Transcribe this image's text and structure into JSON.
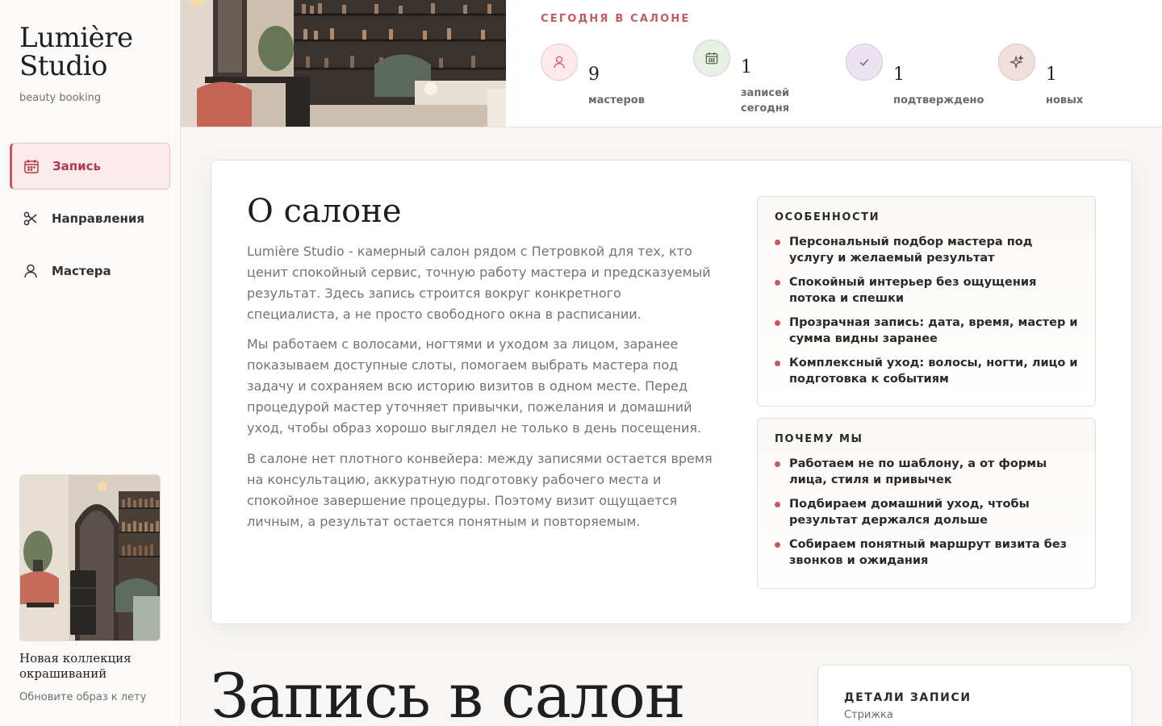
{
  "brand": {
    "name_line1": "Lumière",
    "name_line2": "Studio",
    "subtitle": "beauty booking"
  },
  "sidebar": {
    "items": [
      {
        "label": "Запись",
        "icon": "calendar-icon",
        "active": true
      },
      {
        "label": "Направления",
        "icon": "scissors-icon",
        "active": false
      },
      {
        "label": "Мастера",
        "icon": "user-icon",
        "active": false
      }
    ],
    "promo": {
      "title": "Новая коллекция окрашиваний",
      "subtitle": "Обновите образ к лету"
    }
  },
  "today": {
    "label": "СЕГОДНЯ В САЛОНЕ",
    "stats": [
      {
        "value": "9",
        "caption": "мастеров",
        "icon": "user-icon",
        "color": "#fbe9ec"
      },
      {
        "value": "1",
        "caption": "записей сегодня",
        "icon": "calendar-icon",
        "color": "#e8efe5"
      },
      {
        "value": "1",
        "caption": "подтверждено",
        "icon": "check-icon",
        "color": "#ebe3f2"
      },
      {
        "value": "1",
        "caption": "новых",
        "icon": "sparkle-icon",
        "color": "#efe0dd"
      }
    ]
  },
  "about": {
    "title": "О салоне",
    "paragraphs": [
      "Lumière Studio - камерный салон рядом с Петровкой для тех, кто ценит спокойный сервис, точную работу мастера и предсказуемый результат. Здесь запись строится вокруг конкретного специалиста, а не просто свободного окна в расписании.",
      "Мы работаем с волосами, ногтями и уходом за лицом, заранее показываем доступные слоты, помогаем выбрать мастера под задачу и сохраняем всю историю визитов в одном месте. Перед процедурой мастер уточняет привычки, пожелания и домашний уход, чтобы образ хорошо выглядел не только в день посещения.",
      "В салоне нет плотного конвейера: между записями остается время на консультацию, аккуратную подготовку рабочего места и спокойное завершение процедуры. Поэтому визит ощущается личным, а результат остается понятным и повторяемым."
    ],
    "features": {
      "title": "ОСОБЕННОСТИ",
      "items": [
        "Персональный подбор мастера под услугу и желаемый результат",
        "Спокойный интерьер без ощущения потока и спешки",
        "Прозрачная запись: дата, время, мастер и сумма видны заранее",
        "Комплексный уход: волосы, ногти, лицо и подготовка к событиям"
      ]
    },
    "why": {
      "title": "ПОЧЕМУ МЫ",
      "items": [
        "Работаем не по шаблону, а от формы лица, стиля и привычек",
        "Подбираем домашний уход, чтобы результат держался дольше",
        "Собираем понятный маршрут визита без звонков и ожидания"
      ]
    }
  },
  "booking": {
    "title": "Запись в салон",
    "details_title": "ДЕТАЛИ ЗАПИСИ",
    "details_service": "Стрижка"
  }
}
